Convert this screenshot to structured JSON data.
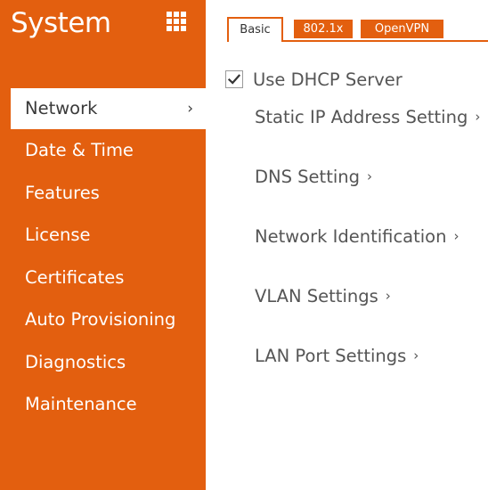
{
  "sidebar": {
    "title": "System",
    "background": "#e35f0f",
    "active_chevron": "›",
    "items": [
      {
        "label": "Network",
        "active": true
      },
      {
        "label": "Date & Time"
      },
      {
        "label": "Features"
      },
      {
        "label": "License"
      },
      {
        "label": "Certificates"
      },
      {
        "label": "Auto Provisioning"
      },
      {
        "label": "Diagnostics"
      },
      {
        "label": "Maintenance"
      }
    ]
  },
  "header": {
    "grid_icon": "apps-grid-icon"
  },
  "tabs": [
    {
      "label": "Basic",
      "active": true
    },
    {
      "label": "802.1x"
    },
    {
      "label": "OpenVPN"
    }
  ],
  "main": {
    "dhcp": {
      "label": "Use DHCP Server",
      "checked": true
    },
    "sections": [
      {
        "label": "Static IP Address Setting",
        "chevron": "›"
      },
      {
        "label": "DNS Setting",
        "chevron": "›"
      },
      {
        "label": "Network Identification",
        "chevron": "›"
      },
      {
        "label": "VLAN Settings",
        "chevron": "›"
      },
      {
        "label": "LAN Port Settings",
        "chevron": "›"
      }
    ]
  },
  "colors": {
    "accent": "#e35f0f",
    "text": "#555555",
    "active_text": "#3a3a3a"
  }
}
